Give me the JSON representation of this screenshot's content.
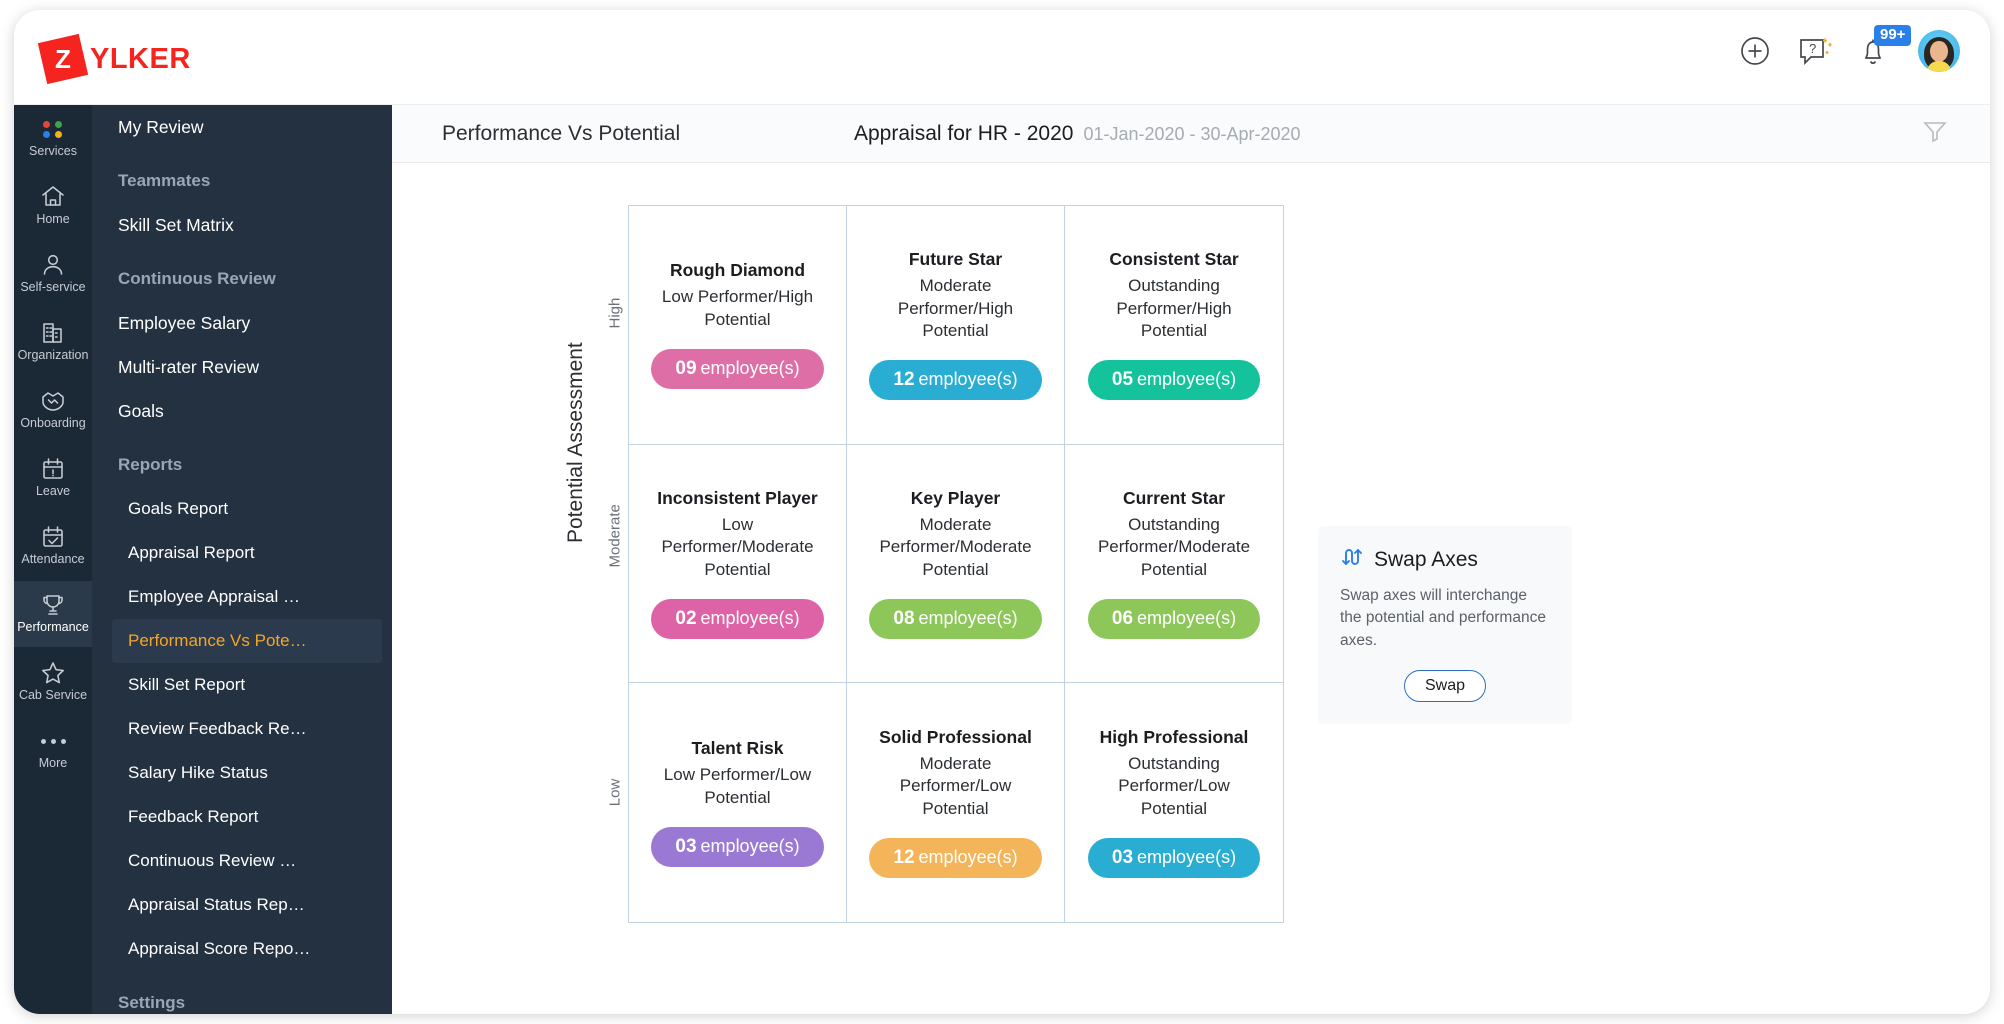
{
  "brand": {
    "mark_letter": "Z",
    "name": "YLKER",
    "color": "#f5241f"
  },
  "topbar": {
    "icons": [
      {
        "name": "add-icon",
        "label": "Add"
      },
      {
        "name": "help-icon",
        "label": "Help"
      },
      {
        "name": "notifications-icon",
        "label": "Notifications"
      }
    ],
    "notification_count": "99+",
    "avatar_label": "User profile"
  },
  "rail": {
    "items": [
      {
        "label": "Services",
        "icon": "services-dots-icon",
        "active": false
      },
      {
        "label": "Home",
        "icon": "home-icon",
        "active": false
      },
      {
        "label": "Self-service",
        "icon": "user-icon",
        "active": false
      },
      {
        "label": "Organization",
        "icon": "buildings-icon",
        "active": false
      },
      {
        "label": "Onboarding",
        "icon": "handshake-icon",
        "active": false
      },
      {
        "label": "Leave",
        "icon": "calendar-alert-icon",
        "active": false
      },
      {
        "label": "Attendance",
        "icon": "calendar-check-icon",
        "active": false
      },
      {
        "label": "Performance",
        "icon": "trophy-icon",
        "active": true
      },
      {
        "label": "Cab Service",
        "icon": "star-icon",
        "active": false
      },
      {
        "label": "More",
        "icon": "ellipsis-icon",
        "active": false
      }
    ],
    "dot_colors": [
      "#e0463c",
      "#3ea34a",
      "#2b7fe8",
      "#f2b01e"
    ]
  },
  "nav": {
    "items": [
      {
        "label": "My Review",
        "type": "item"
      },
      {
        "label": "Teammates",
        "type": "group"
      },
      {
        "label": "Skill Set Matrix",
        "type": "item"
      },
      {
        "label": "Continuous Review",
        "type": "group"
      },
      {
        "label": "Employee Salary",
        "type": "item"
      },
      {
        "label": "Multi-rater Review",
        "type": "item"
      },
      {
        "label": "Goals",
        "type": "item"
      },
      {
        "label": "Reports",
        "type": "group"
      },
      {
        "label": "Goals Report",
        "type": "sub"
      },
      {
        "label": "Appraisal Report",
        "type": "sub"
      },
      {
        "label": "Employee Appraisal …",
        "type": "sub"
      },
      {
        "label": "Performance Vs Pote…",
        "type": "selected"
      },
      {
        "label": "Skill Set Report",
        "type": "sub"
      },
      {
        "label": "Review Feedback Re…",
        "type": "sub"
      },
      {
        "label": "Salary Hike Status",
        "type": "sub"
      },
      {
        "label": "Feedback Report",
        "type": "sub"
      },
      {
        "label": "Continuous Review …",
        "type": "sub"
      },
      {
        "label": "Appraisal Status Rep…",
        "type": "sub"
      },
      {
        "label": "Appraisal Score Repo…",
        "type": "sub"
      },
      {
        "label": "Settings",
        "type": "group"
      }
    ]
  },
  "subheader": {
    "title": "Performance Vs Potential",
    "report_name": "Appraisal for HR - 2020",
    "date_range": "01-Jan-2020 - 30-Apr-2020",
    "filter_icon": "filter-icon"
  },
  "chart_data": {
    "type": "heatmap",
    "title": "Performance Vs Potential",
    "ylabel": "Potential Assessment",
    "xlabel": "",
    "y_ticks": [
      "High",
      "Moderate",
      "Low"
    ],
    "cells": [
      {
        "row": "High",
        "col": "Low",
        "title": "Rough Diamond",
        "desc": "Low Performer/High Potential",
        "count": "09",
        "unit": "employee(s)",
        "color": "#dd6fa6"
      },
      {
        "row": "High",
        "col": "Moderate",
        "title": "Future Star",
        "desc": "Moderate Performer/High Potential",
        "count": "12",
        "unit": "employee(s)",
        "color": "#29add3"
      },
      {
        "row": "High",
        "col": "Outstanding",
        "title": "Consistent Star",
        "desc": "Outstanding Performer/High Potential",
        "count": "05",
        "unit": "employee(s)",
        "color": "#14c39b"
      },
      {
        "row": "Moderate",
        "col": "Low",
        "title": "Inconsistent Player",
        "desc": "Low Performer/Moderate Potential",
        "count": "02",
        "unit": "employee(s)",
        "color": "#de63a6"
      },
      {
        "row": "Moderate",
        "col": "Moderate",
        "title": "Key Player",
        "desc": "Moderate Performer/Moderate Potential",
        "count": "08",
        "unit": "employee(s)",
        "color": "#8dc75a"
      },
      {
        "row": "Moderate",
        "col": "Outstanding",
        "title": "Current Star",
        "desc": "Outstanding Performer/Moderate Potential",
        "count": "06",
        "unit": "employee(s)",
        "color": "#8dc75a"
      },
      {
        "row": "Low",
        "col": "Low",
        "title": "Talent Risk",
        "desc": "Low Performer/Low Potential",
        "count": "03",
        "unit": "employee(s)",
        "color": "#9a79d4"
      },
      {
        "row": "Low",
        "col": "Moderate",
        "title": "Solid Professional",
        "desc": "Moderate Performer/Low Potential",
        "count": "12",
        "unit": "employee(s)",
        "color": "#f4b459"
      },
      {
        "row": "Low",
        "col": "Outstanding",
        "title": "High Professional",
        "desc": "Outstanding Performer/Low Potential",
        "count": "03",
        "unit": "employee(s)",
        "color": "#29add3"
      }
    ]
  },
  "swap_card": {
    "icon": "swap-arrows-icon",
    "title": "Swap Axes",
    "description": "Swap axes will interchange the potential and performance axes.",
    "button_label": "Swap"
  }
}
